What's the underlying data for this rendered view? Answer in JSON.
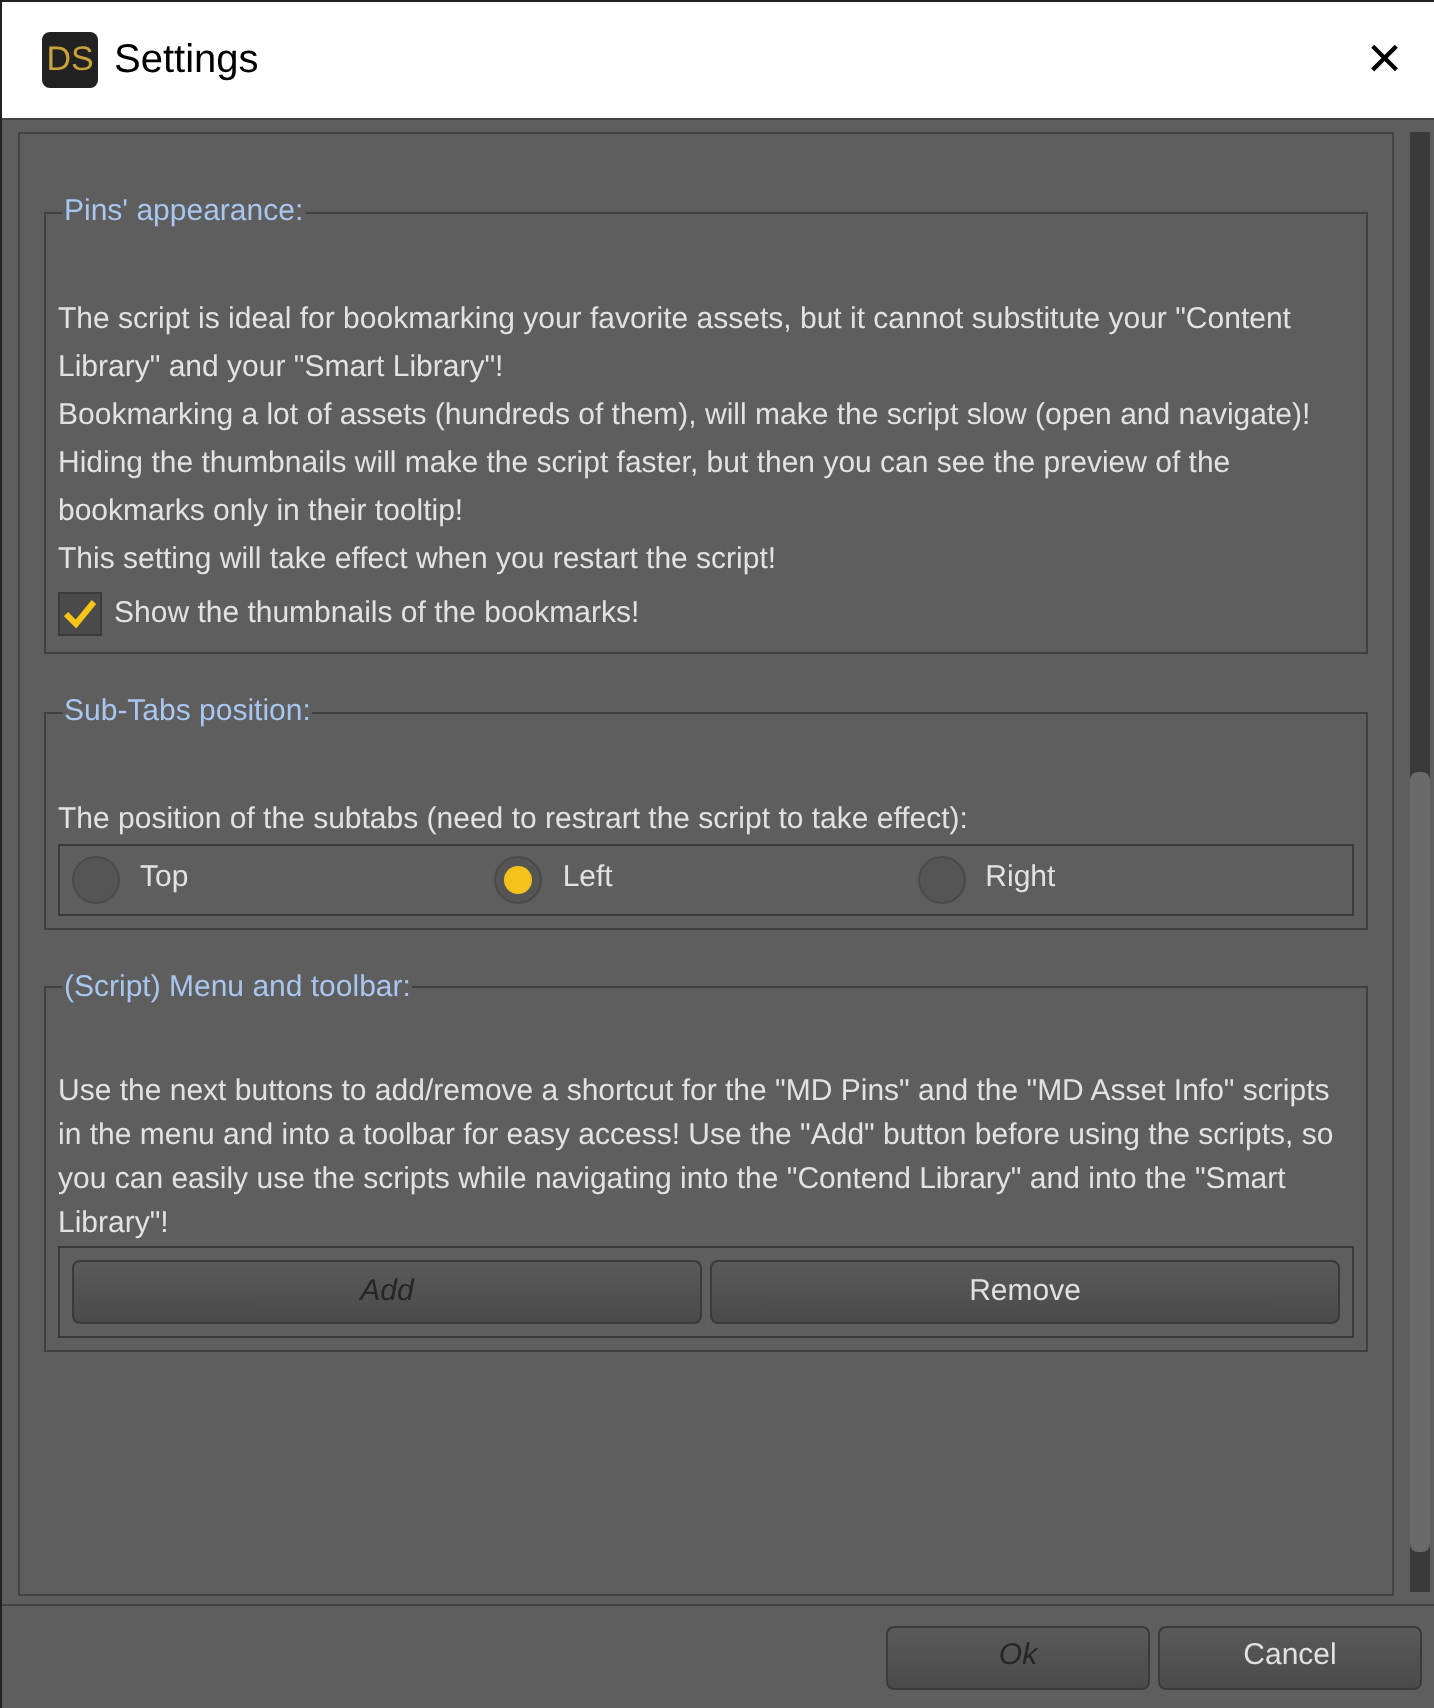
{
  "window": {
    "title": "Settings",
    "logo": "DS",
    "close": "×"
  },
  "pins": {
    "legend": "Pins' appearance:",
    "paragraphs": [
      "The script is ideal for bookmarking your favorite assets, but it cannot substitute your \"Content Library\" and your \"Smart Library\"!",
      "Bookmarking a lot of assets (hundreds of them), will make the script slow (open and navigate)!",
      "Hiding the thumbnails will make the script faster, but then you can see the preview of the bookmarks only in their tooltip!",
      "This setting will take effect when you restart the script!"
    ],
    "checkbox": {
      "label": "Show the thumbnails of the bookmarks!",
      "checked": true
    }
  },
  "subtabs": {
    "legend": "Sub-Tabs position:",
    "text": "The position of the subtabs (need to restrart the script to take effect):",
    "options": [
      {
        "label": "Top",
        "selected": false
      },
      {
        "label": "Left",
        "selected": true
      },
      {
        "label": "Right",
        "selected": false
      }
    ]
  },
  "menu": {
    "legend": "(Script) Menu and toolbar:",
    "text": "Use the next buttons to add/remove a shortcut for the \"MD Pins\" and the \"MD Asset Info\" scripts in the menu and into a toolbar for easy access! Use the \"Add\" button before using the scripts, so you can easily use the scripts while navigating into the \"Contend Library\" and into the \"Smart Library\"!",
    "buttons": [
      {
        "label": "Add",
        "disabled": true
      },
      {
        "label": "Remove",
        "disabled": false
      }
    ]
  },
  "footer_buttons": [
    {
      "label": "Ok",
      "disabled": true
    },
    {
      "label": "Cancel",
      "disabled": false
    }
  ]
}
